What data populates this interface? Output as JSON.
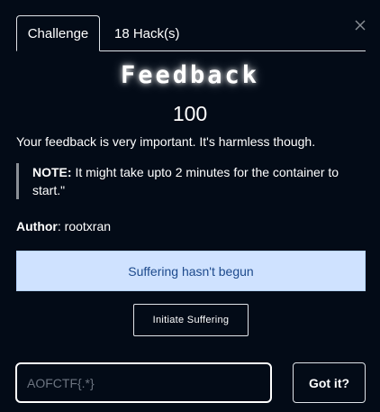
{
  "tabs": [
    {
      "label": "Challenge",
      "active": true
    },
    {
      "label": "18 Hack(s)",
      "active": false
    }
  ],
  "close_icon": "close-icon",
  "challenge": {
    "name": "Feedback",
    "points": "100",
    "description": "Your feedback is very important. It's harmless though.",
    "note_label": "NOTE:",
    "note_text": " It might take upto 2 minutes for the container to start.\"",
    "author_label": "Author",
    "author_value": ": rootxran"
  },
  "status": {
    "text": "Suffering hasn't begun",
    "background": "#cfe2ff",
    "color": "#1d4a8c"
  },
  "initiate_button": {
    "label": "Initiate Suffering"
  },
  "flag_form": {
    "placeholder": "AOFCTF{.*}",
    "value": "",
    "submit_label": "Got it?"
  },
  "colors": {
    "background": "#030b17",
    "text": "#ffffff",
    "border": "#dfe3e8"
  }
}
